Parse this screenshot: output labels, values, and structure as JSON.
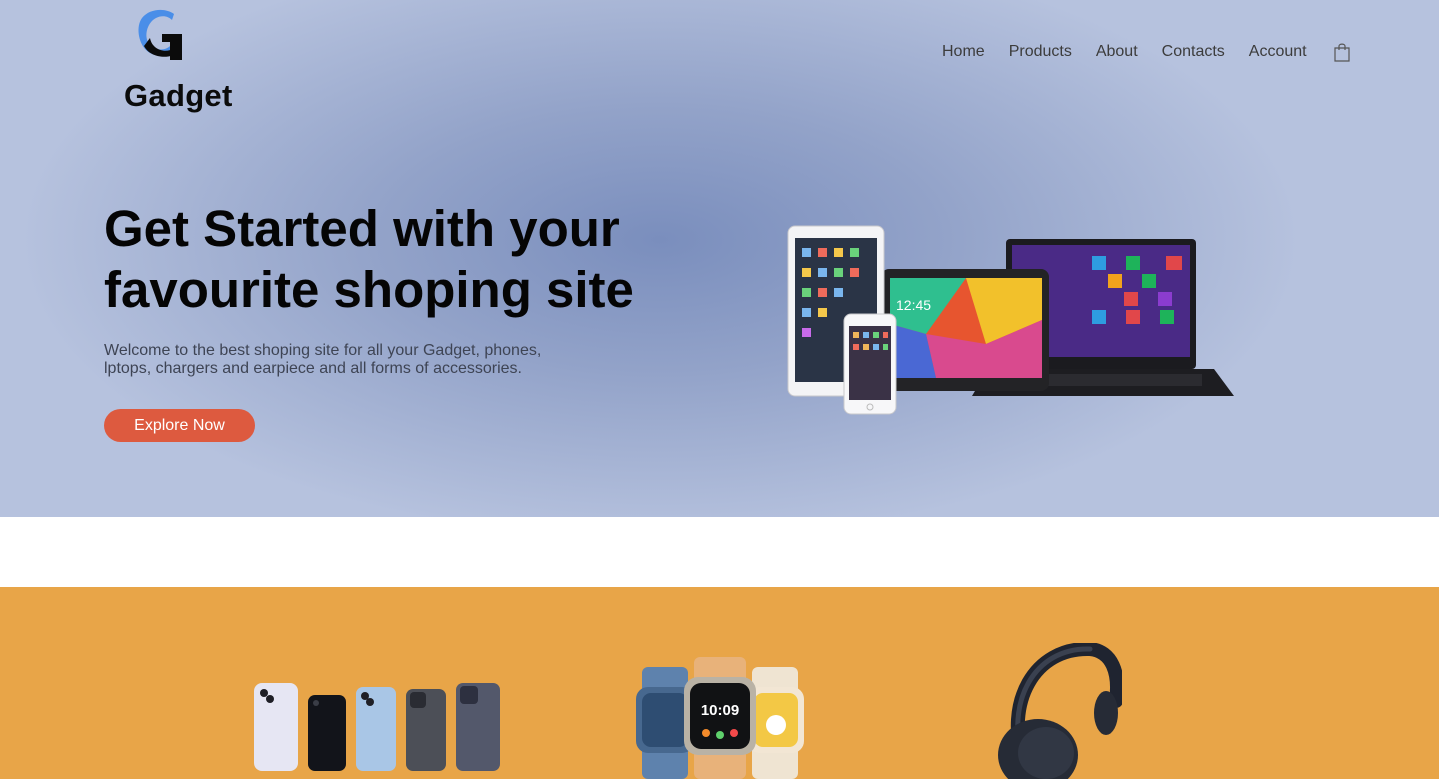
{
  "brand": {
    "name": "Gadget",
    "accent": "#dd5a3f",
    "logo_colors": [
      "#4a8ee8",
      "#0b0b0b"
    ]
  },
  "nav": {
    "items": [
      "Home",
      "Products",
      "About",
      "Contacts",
      "Account"
    ],
    "cart_icon": "shopping-bag-icon"
  },
  "hero": {
    "headline_line1": "Get Started with your",
    "headline_line2": "favourite shoping site",
    "subtext_line1": "Welcome to the best shoping site for all your Gadget, phones,",
    "subtext_line2": "lptops, chargers and earpiece and all forms of accessories.",
    "cta_label": "Explore Now",
    "image": "devices-illustration",
    "screen_clock": "12:45"
  },
  "featured": {
    "background": "#e8a548",
    "items": [
      {
        "name": "phones-image"
      },
      {
        "name": "watches-image",
        "watch_time": "10:09"
      },
      {
        "name": "headphones-image"
      }
    ]
  }
}
